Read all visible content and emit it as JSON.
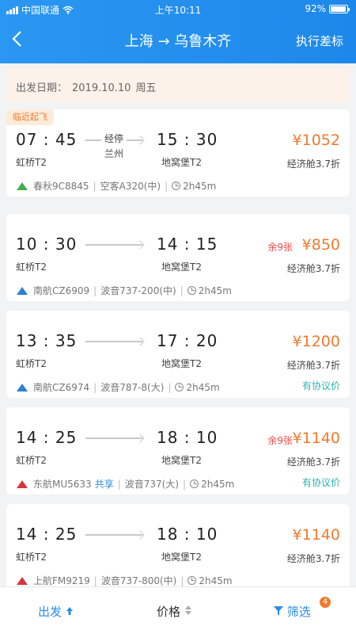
{
  "status_bar": {
    "carrier": "中国联通",
    "time": "上午10:11",
    "battery": "92%"
  },
  "nav": {
    "back_icon": "chevron-left-icon",
    "title": "上海 → 乌鲁木齐",
    "right_action": "执行差标"
  },
  "date_bar": {
    "label": "出发日期：",
    "date": "2019.10.10",
    "weekday": "周五"
  },
  "flights": [
    {
      "badge": "临近起飞",
      "dep_time": "07 : 45",
      "dep_terminal": "虹桥T2",
      "stop_label": "经停",
      "stop_city": "兰州",
      "arr_time": "15 : 30",
      "arr_terminal": "地窝堡T2",
      "remaining": "",
      "price": "¥1052",
      "cabin": "经济舱3.7折",
      "airline": "春秋9C8845",
      "share": "",
      "aircraft": "空客A320(中)",
      "duration": "2h45m",
      "agreement": "",
      "logo_color": "#3fb04b"
    },
    {
      "badge": "",
      "dep_time": "10 : 30",
      "dep_terminal": "虹桥T2",
      "stop_label": "",
      "stop_city": "",
      "arr_time": "14 : 15",
      "arr_terminal": "地窝堡T2",
      "remaining": "余9张",
      "price": "¥850",
      "cabin": "经济舱3.7折",
      "airline": "南航CZ6909",
      "share": "",
      "aircraft": "波音737-200(中)",
      "duration": "2h45m",
      "agreement": "",
      "logo_color": "#2f7fd1"
    },
    {
      "badge": "",
      "dep_time": "13 : 35",
      "dep_terminal": "虹桥T2",
      "stop_label": "",
      "stop_city": "",
      "arr_time": "17 : 20",
      "arr_terminal": "地窝堡T2",
      "remaining": "",
      "price": "¥1200",
      "cabin": "经济舱3.7折",
      "airline": "南航CZ6974",
      "share": "",
      "aircraft": "波音787-8(大)",
      "duration": "2h45m",
      "agreement": "有协议价",
      "logo_color": "#2f7fd1"
    },
    {
      "badge": "",
      "dep_time": "14 : 25",
      "dep_terminal": "虹桥T2",
      "stop_label": "",
      "stop_city": "",
      "arr_time": "18 : 10",
      "arr_terminal": "地窝堡T2",
      "remaining": "余9张",
      "price": "¥1140",
      "cabin": "经济舱3.7折",
      "airline": "东航MU5633",
      "share": "共享",
      "aircraft": "波音737(大)",
      "duration": "2h45m",
      "agreement": "有协议价",
      "logo_color": "#d8343b"
    },
    {
      "badge": "",
      "dep_time": "14 : 25",
      "dep_terminal": "虹桥T2",
      "stop_label": "",
      "stop_city": "",
      "arr_time": "18 : 10",
      "arr_terminal": "地窝堡T2",
      "remaining": "",
      "price": "¥1140",
      "cabin": "经济舱3.7折",
      "airline": "上航FM9219",
      "share": "",
      "aircraft": "波音737-800(中)",
      "duration": "2h45m",
      "agreement": "",
      "logo_color": "#d8343b"
    }
  ],
  "bottom_bar": {
    "depart": "出发",
    "depart_icon": "arrow-up-icon",
    "price": "价格",
    "price_icon": "sort-icon",
    "filter": "筛选",
    "filter_icon": "funnel-icon",
    "filter_count": "4"
  },
  "colors": {
    "brand": "#1e88ea",
    "price": "#f07a2c",
    "remaining": "#f04848",
    "agreement": "#2cb3b0"
  }
}
